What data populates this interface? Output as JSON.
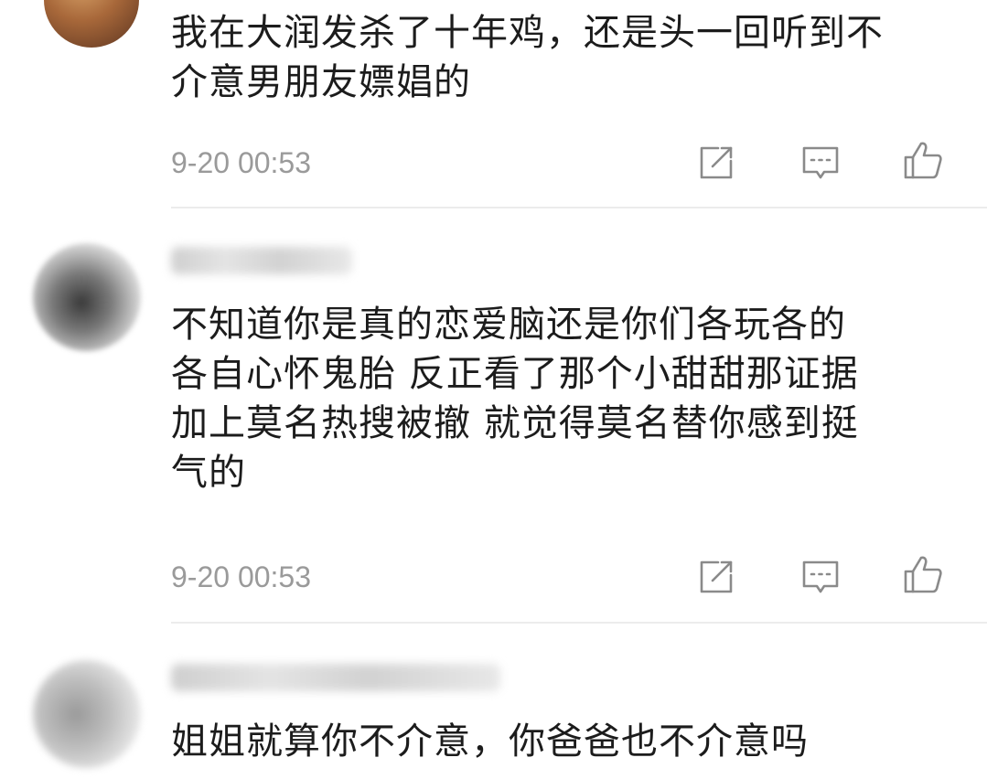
{
  "comments": [
    {
      "text": "我在大润发杀了十年鸡，还是头一回听到不\n介意男朋友嫖娼的",
      "time": "9-20 00:53",
      "icons": [
        "share-icon",
        "reply-icon",
        "like-icon"
      ]
    },
    {
      "text": "不知道你是真的恋爱脑还是你们各玩各的\n各自心怀鬼胎 反正看了那个小甜甜那证据\n加上莫名热搜被撤 就觉得莫名替你感到挺\n气的",
      "time": "9-20 00:53",
      "icons": [
        "share-icon",
        "reply-icon",
        "like-icon"
      ]
    },
    {
      "text": "姐姐就算你不介意，你爸爸也不介意吗"
    }
  ],
  "colors": {
    "text": "#1c1c1c",
    "time": "#9a9a9a",
    "icon": "#8a8a8a",
    "divider": "#ececec"
  }
}
